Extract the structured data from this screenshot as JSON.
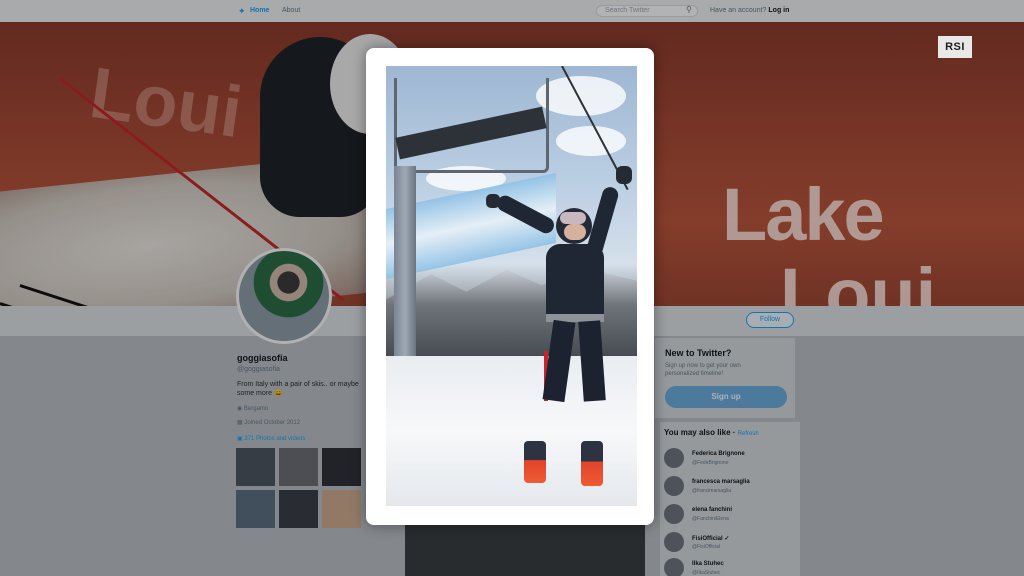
{
  "twitter_nav": {
    "home_label": "Home",
    "about_label": "About",
    "search_placeholder": "Search Twitter",
    "login_prompt": "Have an account?",
    "login_link": "Log in"
  },
  "banner": {
    "lake_text_1": "Lake",
    "lake_text_2": "Loui",
    "loui_text": "Loui"
  },
  "profile": {
    "name": "goggiasofia",
    "handle": "@goggiasofia",
    "bio": "From Italy with a pair of skis.. or maybe some more 😄",
    "location": "Bergamo",
    "joined": "Joined October 2012",
    "photos_label": "371 Photos and videos",
    "follow_label": "Follow"
  },
  "sidebar": {
    "new_title": "New to Twitter?",
    "new_subtitle": "Sign up now to get your own personalized timeline!",
    "signup_label": "Sign up",
    "youmay_title": "You may also like",
    "refresh_label": "Refresh",
    "suggestions": [
      {
        "name": "Federica Brignone",
        "handle": "@FedeBrignone"
      },
      {
        "name": "francesca marsaglia",
        "handle": "@francimarsaglia"
      },
      {
        "name": "elena fanchini",
        "handle": "@FanchiniElena"
      },
      {
        "name": "FisiOfficial ✓",
        "handle": "@FisiOfficial"
      },
      {
        "name": "Ilka Stuhec",
        "handle": "@IlkaStuhec"
      }
    ]
  },
  "broadcaster": {
    "logo_text": "RSI"
  },
  "icons": {
    "twitter_bird": "bird-icon",
    "search": "search-icon",
    "location": "location-icon",
    "calendar": "calendar-icon",
    "photos": "image-icon"
  }
}
